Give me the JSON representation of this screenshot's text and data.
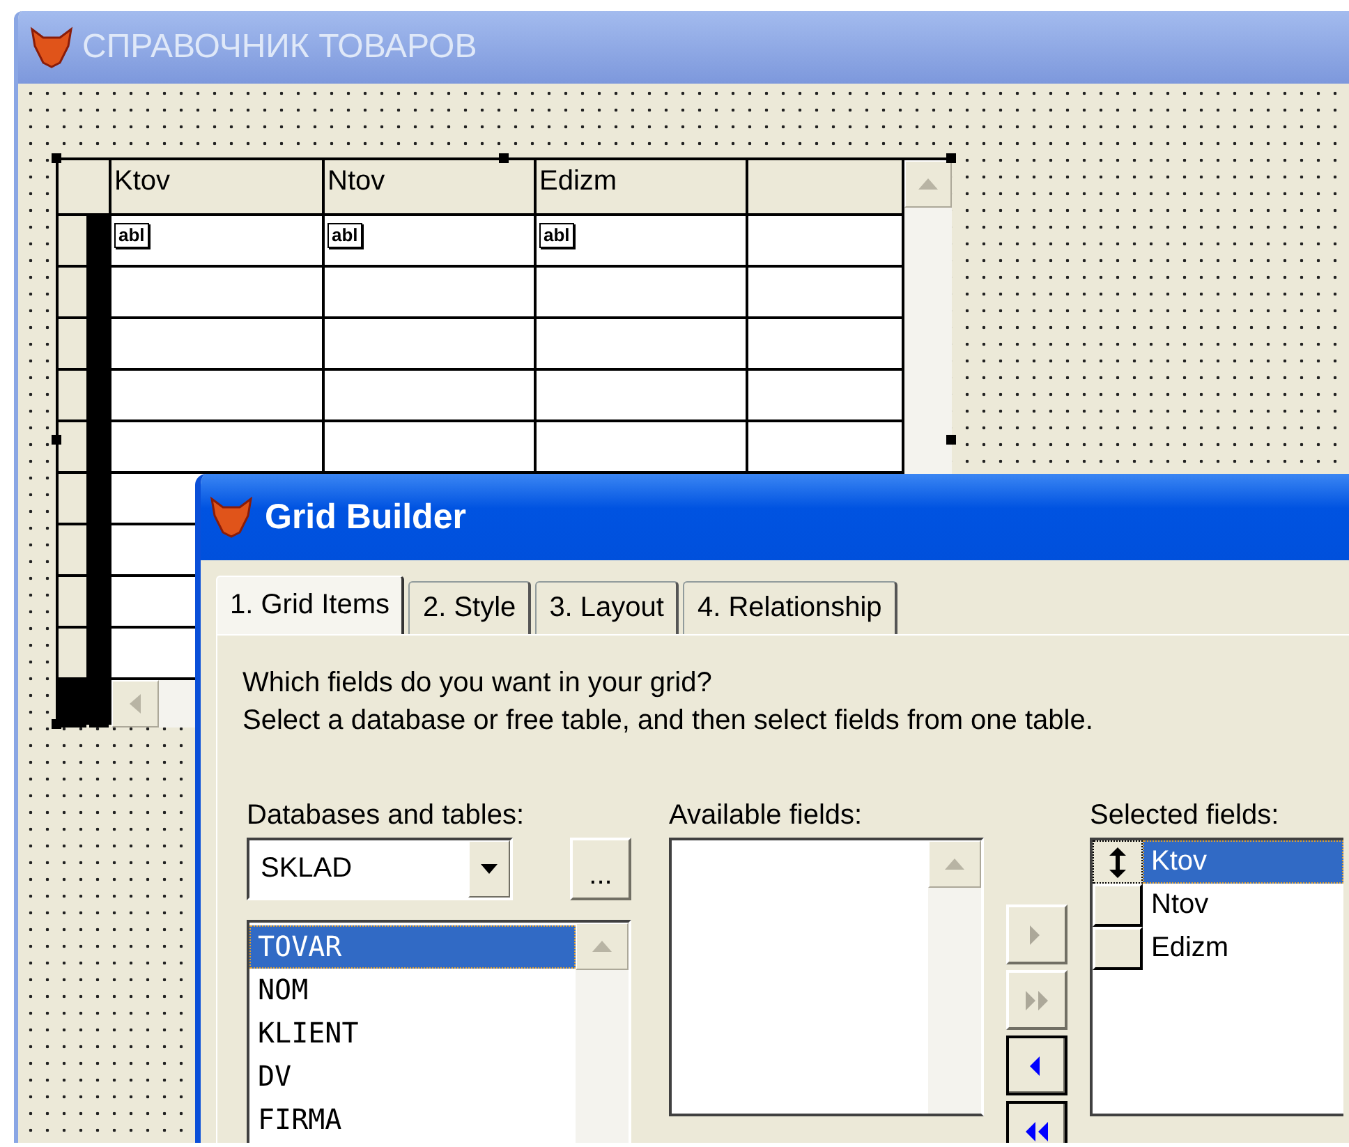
{
  "form_window": {
    "title": "СПРАВОЧНИК ТОВАРОВ"
  },
  "grid": {
    "columns": [
      {
        "header": "Ktov",
        "cell": "abl"
      },
      {
        "header": "Ntov",
        "cell": "abl"
      },
      {
        "header": "Edizm",
        "cell": "abl"
      }
    ]
  },
  "dialog": {
    "title": "Grid Builder",
    "tabs": [
      {
        "label": "1. Grid Items",
        "selected": true
      },
      {
        "label": "2. Style",
        "selected": false
      },
      {
        "label": "3. Layout",
        "selected": false
      },
      {
        "label": "4. Relationship",
        "selected": false
      }
    ],
    "intro": [
      "Which fields do you want in your grid?",
      "Select a database or free table, and then select fields from one table."
    ],
    "databases_label": "Databases and tables:",
    "database": {
      "value": "SKLAD"
    },
    "browse_button": "...",
    "tables": [
      {
        "label": "TOVAR",
        "selected": true
      },
      {
        "label": "NOM",
        "selected": false
      },
      {
        "label": "KLIENT",
        "selected": false
      },
      {
        "label": "DV",
        "selected": false
      },
      {
        "label": "FIRMA",
        "selected": false
      }
    ],
    "available_label": "Available fields:",
    "move_buttons": [
      {
        "kind": "add",
        "disabled": true
      },
      {
        "kind": "add_all",
        "disabled": true
      },
      {
        "kind": "remove",
        "disabled": false
      },
      {
        "kind": "remove_all",
        "disabled": false
      }
    ],
    "selected_label": "Selected fields:",
    "selected_fields": [
      {
        "label": "Ktov",
        "selected": true
      },
      {
        "label": "Ntov",
        "selected": false
      },
      {
        "label": "Edizm",
        "selected": false
      }
    ]
  }
}
